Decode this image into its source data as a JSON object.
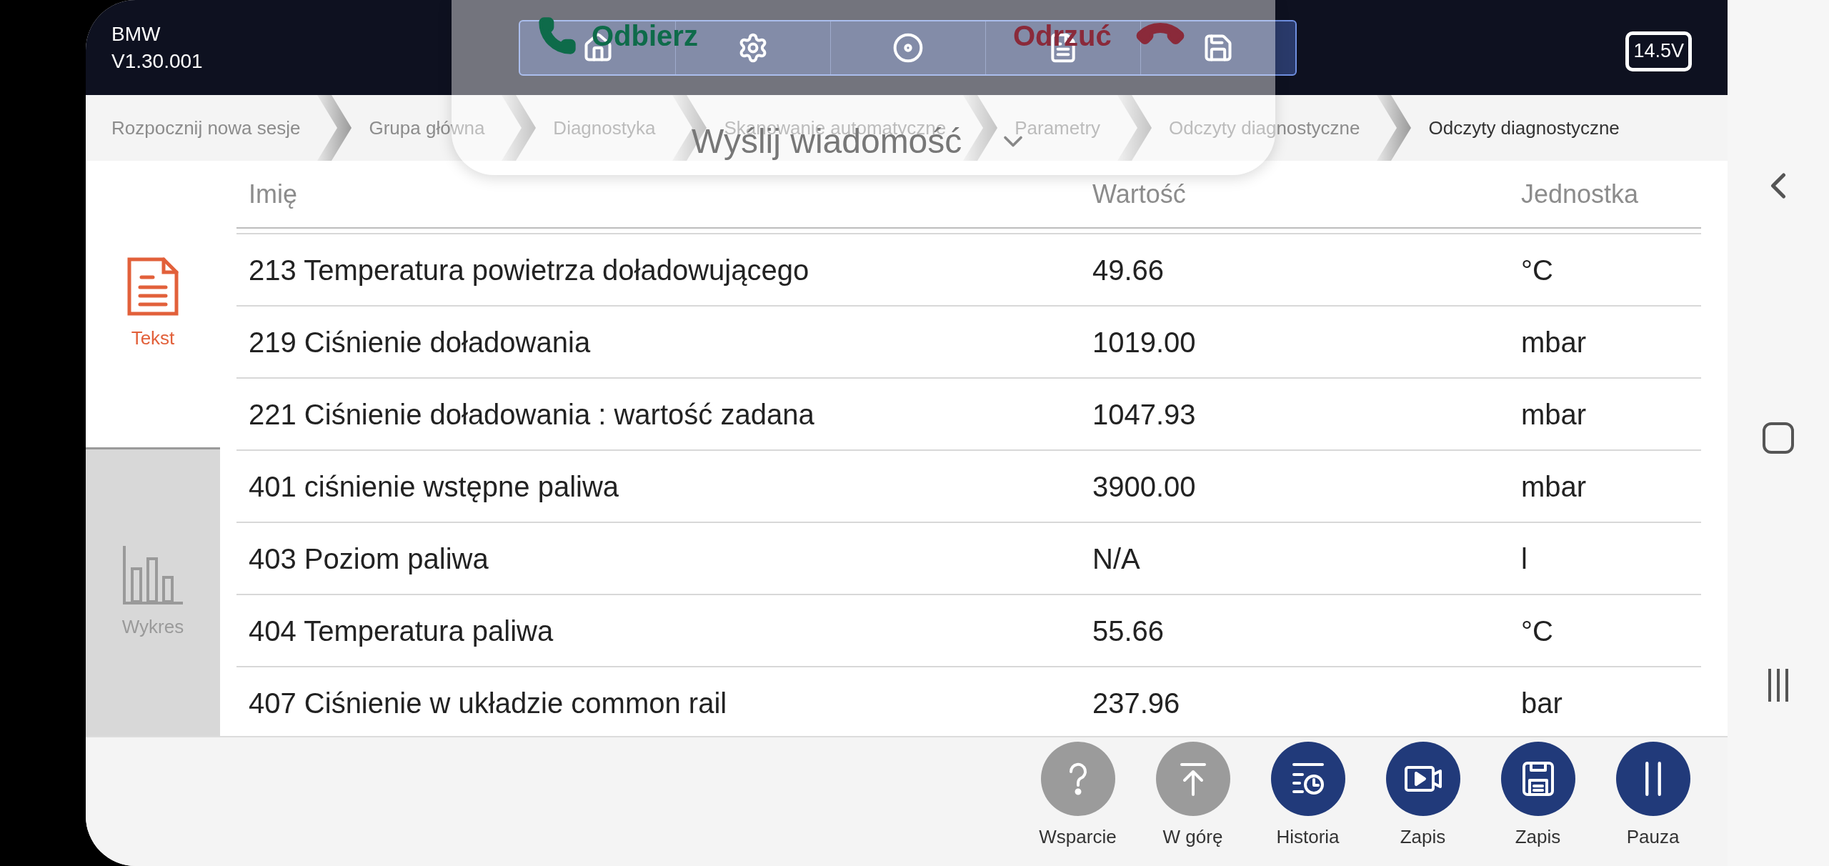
{
  "app": {
    "brand": "BMW",
    "version": "V1.30.001",
    "battery_voltage": "14.5V"
  },
  "breadcrumbs": [
    {
      "label": "Rozpocznij nowa sesje",
      "selected": false
    },
    {
      "label": "Grupa główna",
      "selected": false
    },
    {
      "label": "Diagnostyka",
      "selected": false
    },
    {
      "label": "Skanowanie automatyczne",
      "selected": false
    },
    {
      "label": "Parametry",
      "selected": false
    },
    {
      "label": "Odczyty diagnostyczne",
      "selected": false
    },
    {
      "label": "Odczyty diagnostyczne",
      "selected": true
    }
  ],
  "call_overlay": {
    "accept": "Odbierz",
    "decline": "Odrzuć",
    "message": "Wyślij wiadomość"
  },
  "view_tabs": [
    {
      "label": "Tekst",
      "kind": "text",
      "selected": true
    },
    {
      "label": "Wykres",
      "kind": "chart",
      "selected": false
    }
  ],
  "table": {
    "columns": [
      "Imię",
      "Wartość",
      "Jednostka"
    ],
    "rows": [
      [
        "213 Temperatura powietrza doładowującego",
        "49.66",
        "°C"
      ],
      [
        "219 Ciśnienie doładowania",
        "1019.00",
        "mbar"
      ],
      [
        "221 Ciśnienie doładowania : wartość zadana",
        "1047.93",
        "mbar"
      ],
      [
        "401 ciśnienie wstępne paliwa",
        "3900.00",
        "mbar"
      ],
      [
        "403 Poziom paliwa",
        "N/A",
        "l"
      ],
      [
        "404 Temperatura paliwa",
        "55.66",
        "°C"
      ],
      [
        "407 Ciśnienie w układzie common rail",
        "237.96",
        "bar"
      ]
    ]
  },
  "actions": [
    {
      "label": "Wsparcie",
      "kind": "help",
      "disabled": true
    },
    {
      "label": "W górę",
      "kind": "top",
      "disabled": true
    },
    {
      "label": "Historia",
      "kind": "history",
      "disabled": false
    },
    {
      "label": "Zapis",
      "kind": "record",
      "disabled": false
    },
    {
      "label": "Zapis",
      "kind": "save",
      "disabled": false
    },
    {
      "label": "Pauza",
      "kind": "pause",
      "disabled": false
    }
  ]
}
